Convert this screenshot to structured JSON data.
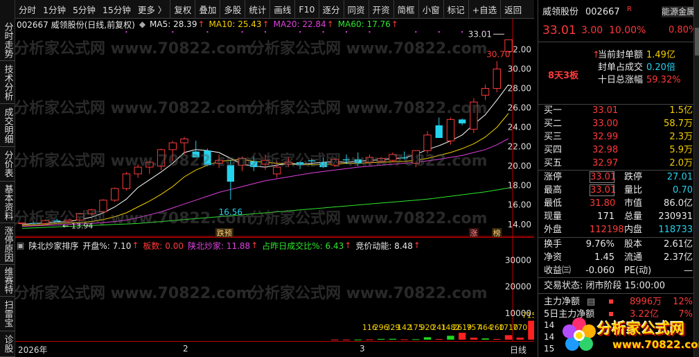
{
  "left_tabs": [
    "分时走势",
    "技术分析",
    "成交明细",
    "分价表",
    "基本资料",
    "涨停原因",
    "维赛特",
    "扫雷宝",
    "诊股"
  ],
  "toolbar": [
    "分时",
    "1分钟",
    "5分钟",
    "15分钟",
    "更多 〉",
    "复权",
    "叠加",
    "多股",
    "统计",
    "画线",
    "F10",
    "逐分",
    "同资",
    "开资",
    "简框",
    "小窗",
    "标记",
    "+自选",
    "返回"
  ],
  "chart_header": {
    "code_name": "002667 威领股份(日线,前复权)",
    "ma5": "MA5: 28.39",
    "ma10": "MA10: 25.43",
    "ma20": "MA20: 22.84",
    "ma60": "MA60: 17.76",
    "arrow": "↑"
  },
  "annotations": {
    "high_label": "33.01",
    "high2_label": "30.70",
    "low_label": "16.56",
    "first_low": "13.94",
    "tag_jieyu": "跌预",
    "tag_zhang": "涨",
    "tag_bang": "榜"
  },
  "vol_header": {
    "name": "陕北炒家排序",
    "kaipan": "开盘%: 7.10",
    "banshu": "板数: 0.00",
    "shanbei": "陕北炒家: 11.88",
    "zhanzuo": "占昨日成交比%: 6.43",
    "jingjia": "竞价动能: 8.48",
    "arrow": "↑"
  },
  "date_axis": {
    "year": "2026年",
    "m2": "2",
    "m3": "3",
    "period": "日线"
  },
  "stock": {
    "name": "威领股份",
    "code": "002667",
    "flag": "R",
    "price": "33.01",
    "change": "3.00",
    "pct": "10.00%",
    "sector": "能源金属",
    "sector_pct": "0.80%",
    "streak": "8天3板"
  },
  "seal": [
    {
      "label": "当前封单额",
      "value": "1.49亿",
      "arrow": "↑"
    },
    {
      "label": "封单占成交",
      "value": "0.20倍"
    },
    {
      "label": "十日总涨幅",
      "value": "59.32%"
    }
  ],
  "orderbook": [
    {
      "label": "买一",
      "price": "33.01",
      "vol": "1.5亿"
    },
    {
      "label": "买二",
      "price": "33.00",
      "vol": "58.7万"
    },
    {
      "label": "买三",
      "price": "32.99",
      "vol": "2.3万"
    },
    {
      "label": "买四",
      "price": "32.98",
      "vol": "5.9万"
    },
    {
      "label": "买五",
      "price": "32.97",
      "vol": "2.0万"
    }
  ],
  "quote": [
    {
      "l1": "涨停",
      "v1": "33.01",
      "l2": "跌停",
      "v2": "27.01"
    },
    {
      "l1": "最高",
      "v1": "33.01",
      "l2": "量比",
      "v2": "0.70"
    },
    {
      "l1": "最低",
      "v1": "31.80",
      "l2": "市值",
      "v2": "86.0亿"
    },
    {
      "l1": "现量",
      "v1": "171",
      "l2": "总量",
      "v2": "230931"
    },
    {
      "l1": "外盘",
      "v1": "112198",
      "l2": "内盘",
      "v2": "118733"
    }
  ],
  "stats": [
    {
      "l1": "换手",
      "v1": "9.76%",
      "l2": "股本",
      "v2": "2.61亿"
    },
    {
      "l1": "净资",
      "v1": "1.45",
      "l2": "流通",
      "v2": "2.37亿"
    },
    {
      "l1": "收益㈢",
      "v1": "-0.060",
      "l2": "PE(动)",
      "v2": "—"
    }
  ],
  "trade_state": "交易状态: 闭市阶段 15:00:00",
  "flow": [
    {
      "label": "主力净额",
      "value": "8996万",
      "pct": "12%"
    },
    {
      "label": "5日主力净额",
      "value": "3.22亿",
      "pct": "7%"
    }
  ],
  "flow_extra": [
    "14",
    "14",
    "15"
  ],
  "watermark": "分析家公式网 www.70822.com",
  "logo": {
    "title": "分析家公式网",
    "url": "www.70822.com"
  },
  "colors": {
    "up": "#ff3a3a",
    "down": "#22d3ee",
    "ma5": "#ffffff",
    "ma10": "#f5d000",
    "ma20": "#e040e0",
    "ma60": "#2ee82e"
  },
  "chart_data": [
    {
      "type": "candlestick",
      "yaxis_ticks": [
        "32.00",
        "30.00",
        "28.00",
        "26.00",
        "24.00",
        "22.00",
        "20.00",
        "18.00",
        "16.00",
        "14.00"
      ],
      "ylim": [
        13.2,
        33.6
      ],
      "candles": [
        [
          14.1,
          14.2,
          13.94,
          14.15
        ],
        [
          14.15,
          14.3,
          14.0,
          14.1
        ],
        [
          14.1,
          14.5,
          14.0,
          14.4
        ],
        [
          14.4,
          14.6,
          14.2,
          14.3
        ],
        [
          14.3,
          14.5,
          14.1,
          14.45
        ],
        [
          14.45,
          15.2,
          14.4,
          15.1
        ],
        [
          15.1,
          15.6,
          14.9,
          15.5
        ],
        [
          15.3,
          16.6,
          15.2,
          16.5
        ],
        [
          16.5,
          17.8,
          16.3,
          17.7
        ],
        [
          17.7,
          19.4,
          17.5,
          19.2
        ],
        [
          19.2,
          20.2,
          18.8,
          19.9
        ],
        [
          19.9,
          20.5,
          19.2,
          20.4
        ],
        [
          20.0,
          21.8,
          19.6,
          21.7
        ],
        [
          21.7,
          22.6,
          20.5,
          22.4
        ],
        [
          22.4,
          23.0,
          21.2,
          22.8
        ],
        [
          21.5,
          22.6,
          21.0,
          20.9
        ],
        [
          21.6,
          21.8,
          20.0,
          20.1
        ],
        [
          20.3,
          21.2,
          19.8,
          20.6
        ],
        [
          20.1,
          20.6,
          16.56,
          18.4
        ],
        [
          20.1,
          21.0,
          19.5,
          20.8
        ],
        [
          20.5,
          21.0,
          19.5,
          19.9
        ],
        [
          20.2,
          21.2,
          19.6,
          20.6
        ],
        [
          19.2,
          20.5,
          18.8,
          19.9
        ],
        [
          20.2,
          20.9,
          19.9,
          20.4
        ],
        [
          20.4,
          20.5,
          19.7,
          20.1
        ],
        [
          20.6,
          20.8,
          20.1,
          20.5
        ],
        [
          20.4,
          20.9,
          19.8,
          19.9
        ],
        [
          20.1,
          20.8,
          19.9,
          20.7
        ],
        [
          20.7,
          21.2,
          20.2,
          20.6
        ],
        [
          20.7,
          21.4,
          20.0,
          20.3
        ],
        [
          20.4,
          21.2,
          20.2,
          20.9
        ],
        [
          20.5,
          20.9,
          20.3,
          20.8
        ],
        [
          20.6,
          21.4,
          20.4,
          21.2
        ],
        [
          20.9,
          21.5,
          20.7,
          20.8
        ],
        [
          20.3,
          21.6,
          19.9,
          21.6
        ],
        [
          21.6,
          23.6,
          21.3,
          23.2
        ],
        [
          24.2,
          25.0,
          23.0,
          22.9
        ],
        [
          22.6,
          25.0,
          22.2,
          24.8
        ],
        [
          24.8,
          24.9,
          24.2,
          24.4
        ],
        [
          23.8,
          27.0,
          23.4,
          26.6
        ],
        [
          27.3,
          28.4,
          26.8,
          28.0
        ],
        [
          28.0,
          30.8,
          27.6,
          30.0
        ],
        [
          31.8,
          33.01,
          31.8,
          33.01
        ]
      ],
      "ma5": [
        14.0,
        14.1,
        14.15,
        14.25,
        14.3,
        14.5,
        14.75,
        15.2,
        15.8,
        16.6,
        17.8,
        18.6,
        19.4,
        20.3,
        21.4,
        21.7,
        21.6,
        21.4,
        20.8,
        20.2,
        20.0,
        19.9,
        20.1,
        20.3,
        20.2,
        20.3,
        20.4,
        20.45,
        20.4,
        20.5,
        20.6,
        20.65,
        20.8,
        20.85,
        21.2,
        21.7,
        22.1,
        22.6,
        23.2,
        24.3,
        25.3,
        26.8,
        28.39
      ],
      "ma10": [
        13.9,
        13.95,
        14.0,
        14.1,
        14.15,
        14.2,
        14.3,
        14.5,
        14.8,
        15.2,
        15.8,
        16.4,
        17.1,
        17.9,
        18.9,
        19.6,
        20.1,
        20.5,
        20.6,
        20.7,
        20.5,
        20.4,
        20.3,
        20.2,
        20.2,
        20.15,
        20.2,
        20.2,
        20.3,
        20.3,
        20.35,
        20.4,
        20.45,
        20.5,
        20.6,
        20.8,
        21.1,
        21.4,
        21.8,
        22.3,
        23.0,
        24.0,
        25.43
      ],
      "ma20": [
        13.8,
        13.85,
        13.9,
        13.95,
        14.0,
        14.05,
        14.1,
        14.2,
        14.3,
        14.45,
        14.7,
        15.0,
        15.3,
        15.7,
        16.1,
        16.5,
        16.9,
        17.3,
        17.6,
        17.9,
        18.2,
        18.5,
        18.7,
        18.9,
        19.1,
        19.3,
        19.45,
        19.6,
        19.75,
        19.9,
        20.0,
        20.1,
        20.2,
        20.3,
        20.4,
        20.55,
        20.7,
        20.9,
        21.1,
        21.4,
        21.7,
        22.2,
        22.84
      ],
      "ma60": [
        13.6,
        13.65,
        13.7,
        13.75,
        13.8,
        13.85,
        13.9,
        13.95,
        14.0,
        14.05,
        14.1,
        14.2,
        14.3,
        14.4,
        14.5,
        14.6,
        14.7,
        14.8,
        14.9,
        15.0,
        15.1,
        15.2,
        15.3,
        15.4,
        15.5,
        15.6,
        15.7,
        15.8,
        15.9,
        16.0,
        16.1,
        16.2,
        16.3,
        16.4,
        16.5,
        16.6,
        16.75,
        16.9,
        17.05,
        17.2,
        17.35,
        17.55,
        17.76
      ]
    },
    {
      "type": "bar",
      "yaxis_ticks": [
        "30000",
        "20000",
        "10000"
      ],
      "ylim": [
        0,
        33000
      ],
      "first_bar_index": 27,
      "values": [
        20,
        40,
        60,
        116,
        296,
        329,
        142,
        175,
        920,
        241,
        1482,
        2619,
        757,
        464,
        260,
        1710,
        770,
        7157
      ],
      "colors": [
        "r",
        "r",
        "g",
        "r",
        "g",
        "g",
        "r",
        "g",
        "g",
        "r",
        "g",
        "r",
        "r",
        "g",
        "r",
        "r",
        "r",
        "r"
      ],
      "labels": [
        "",
        "",
        "",
        "116",
        "296",
        "329",
        "142",
        "175",
        "920",
        "241",
        "1482",
        "2619",
        "757",
        "464",
        "260",
        "1710",
        "770",
        "7157"
      ]
    }
  ]
}
